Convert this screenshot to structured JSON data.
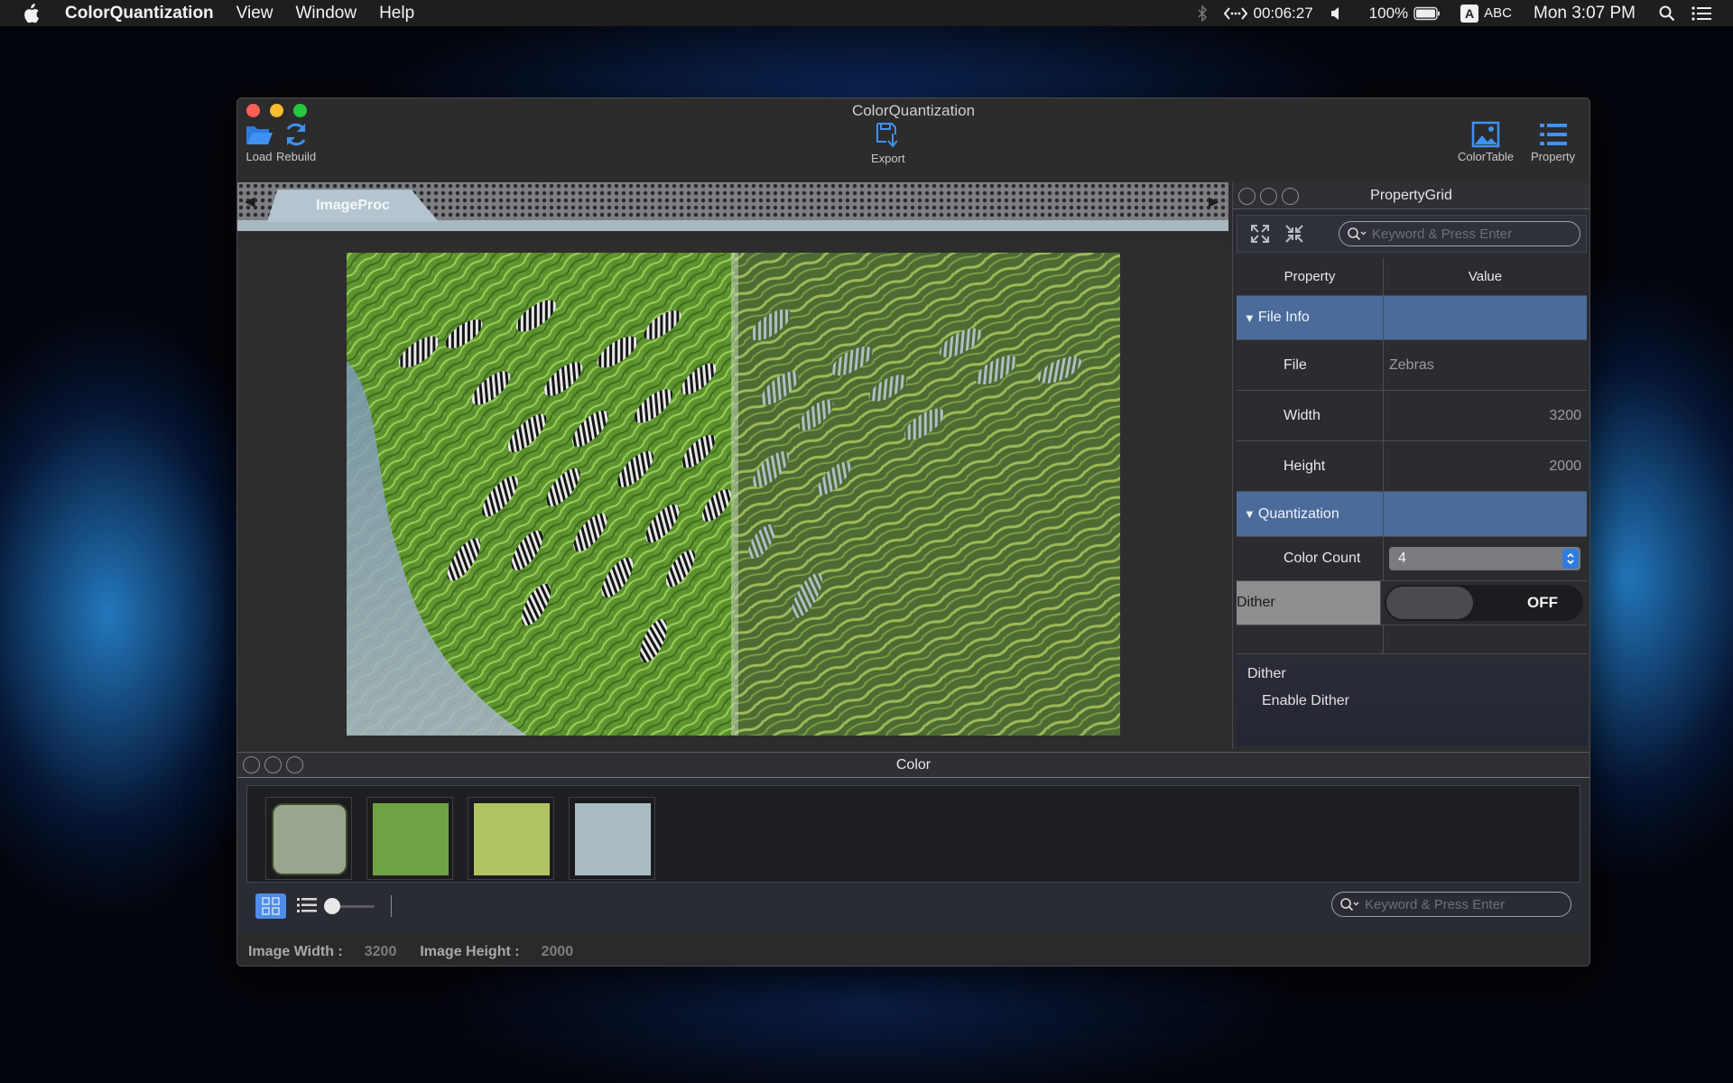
{
  "menubar": {
    "app_name": "ColorQuantization",
    "menus": [
      "View",
      "Window",
      "Help"
    ],
    "timer": "00:06:27",
    "battery": "100%",
    "input_source": "ABC",
    "clock": "Mon 3:07 PM"
  },
  "window": {
    "title": "ColorQuantization",
    "toolbar": {
      "load": "Load",
      "rebuild": "Rebuild",
      "export": "Export",
      "color_table": "ColorTable",
      "property": "Property"
    },
    "tab": "ImageProc"
  },
  "property_grid": {
    "title": "PropertyGrid",
    "search_placeholder": "Keyword & Press Enter",
    "header_property": "Property",
    "header_value": "Value",
    "cat_file_info": "File Info",
    "file_label": "File",
    "file_value": "Zebras",
    "width_label": "Width",
    "width_value": "3200",
    "height_label": "Height",
    "height_value": "2000",
    "cat_quantization": "Quantization",
    "color_count_label": "Color Count",
    "color_count_value": "4",
    "dither_label": "Dither",
    "dither_value": "OFF",
    "desc_title": "Dither",
    "desc_body": "Enable Dither"
  },
  "color_panel": {
    "title": "Color",
    "swatch_colors": [
      "#9aa58e",
      "#6fa244",
      "#b0c562",
      "#a9bcc4"
    ],
    "search_placeholder": "Keyword & Press Enter",
    "view_mode": "grid",
    "size_slider": 0.0
  },
  "status": {
    "width_label": "Image Width :",
    "width_value": "3200",
    "height_label": "Image Height :",
    "height_value": "2000"
  },
  "colors": {
    "accent": "#3b82e0",
    "category_row": "#4b6b9a"
  }
}
